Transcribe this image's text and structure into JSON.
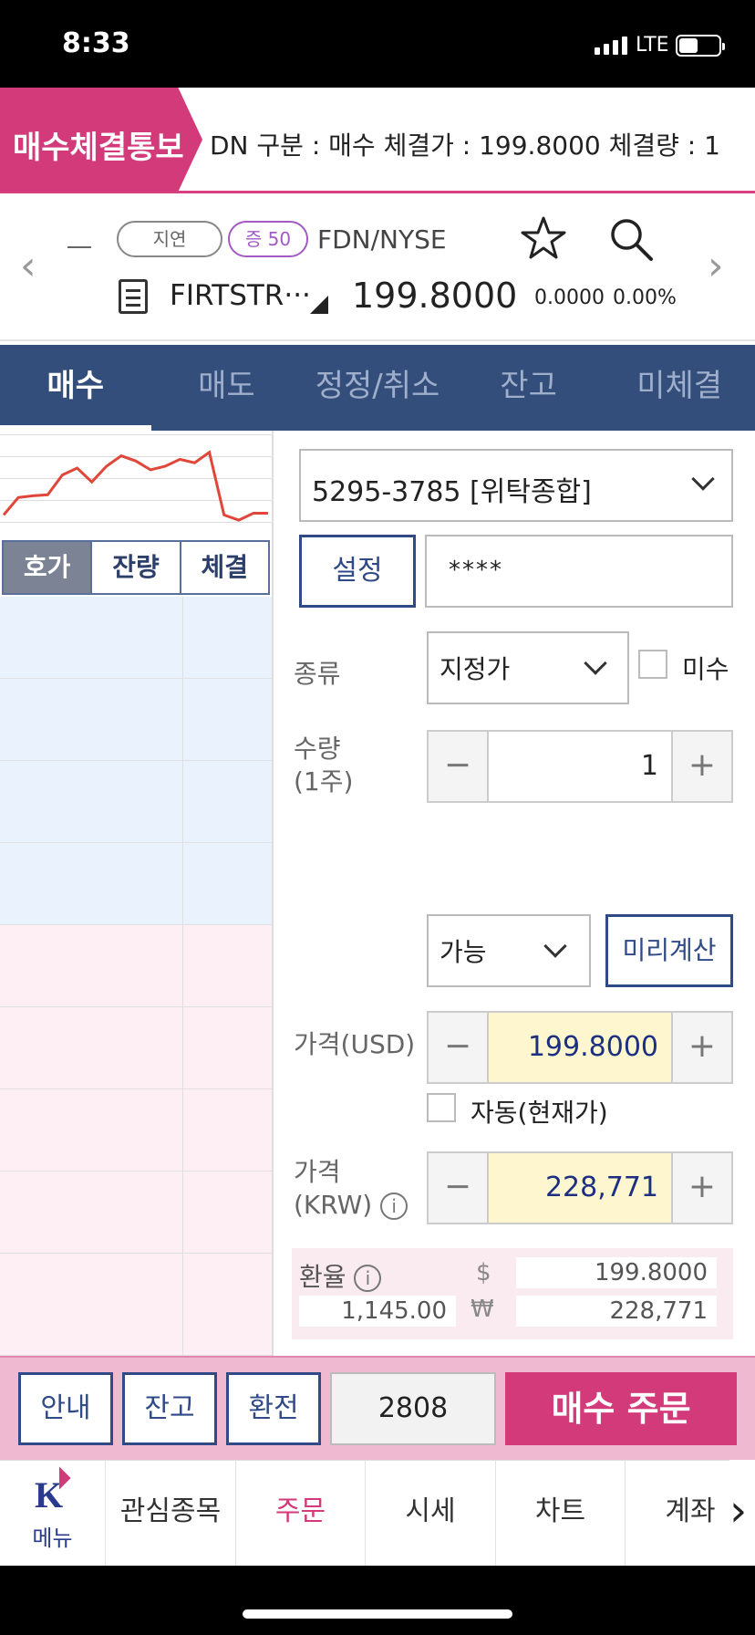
{
  "status_bar": {
    "time": "8:33",
    "carrier": "LTE"
  },
  "notice": {
    "tag": "매수체결통보",
    "text": "DN  구분 : 매수  체결가 : 199.8000  체결량 : 1"
  },
  "stock": {
    "delay_badge": "지연",
    "margin_badge": "증 50",
    "market": "FDN/NYSE",
    "name": "FIRTSTR···",
    "price": "199.8000",
    "change": "0.0000",
    "change_pct": "0.00%"
  },
  "tabs": [
    {
      "label": "매수",
      "active": true
    },
    {
      "label": "매도"
    },
    {
      "label": "정정/취소"
    },
    {
      "label": "잔고"
    },
    {
      "label": "미체결"
    }
  ],
  "orderbook": {
    "subtabs": [
      {
        "label": "호가",
        "active": true
      },
      {
        "label": "잔량"
      },
      {
        "label": "체결"
      }
    ],
    "sparkline": [
      0.2,
      0.7,
      0.75,
      0.78,
      1.35,
      1.55,
      1.15,
      1.6,
      1.9,
      1.75,
      1.5,
      1.6,
      1.8,
      1.7,
      2.0,
      0.2,
      0.05,
      0.25,
      0.25
    ]
  },
  "order_form": {
    "account": "5295-3785 [위탁종합]",
    "setup_button": "설정",
    "password": "****",
    "type_label": "종류",
    "type_value": "지정가",
    "margin_label": "미수",
    "qty_label": "수량",
    "qty_unit": "(1주)",
    "qty_value": "1",
    "avail_value": "가능",
    "precalc_button": "미리계산",
    "price_usd_label": "가격(USD)",
    "price_usd": "199.8000",
    "auto_label": "자동(현재가)",
    "price_krw_label_1": "가격",
    "price_krw_label_2": "(KRW)",
    "price_krw": "228,771",
    "minus": "−",
    "plus": "+",
    "info": "i",
    "fx_label": "환율",
    "fx_rate": "1,145.00",
    "usd_symbol": "$",
    "krw_symbol": "₩",
    "fx_usd": "199.8000",
    "fx_krw": "228,771"
  },
  "action_bar": {
    "guide": "안내",
    "balance": "잔고",
    "exchange": "환전",
    "qty": "2808",
    "order": "매수 주문"
  },
  "bottom_nav": {
    "menu": "메뉴",
    "items": [
      {
        "label": "관심종목"
      },
      {
        "label": "주문",
        "active": true
      },
      {
        "label": "시세"
      },
      {
        "label": "차트"
      },
      {
        "label": "계좌"
      }
    ]
  },
  "colors": {
    "accent": "#d23a7a",
    "navy": "#344e7c",
    "chart_line": "#e0463a"
  }
}
